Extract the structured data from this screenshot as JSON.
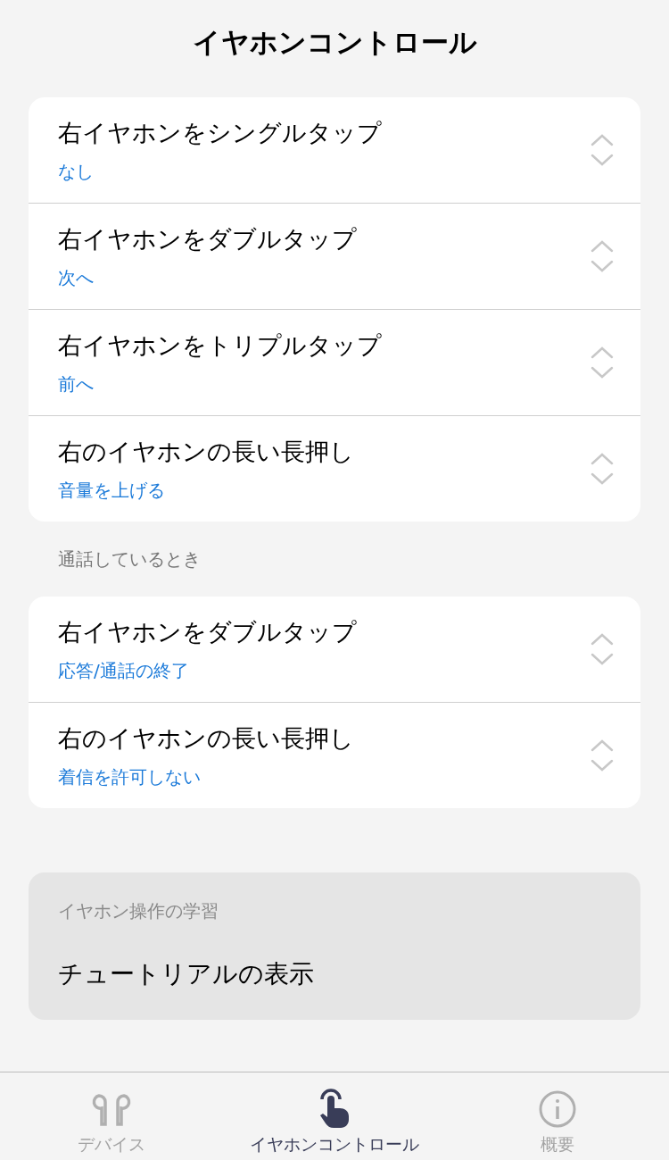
{
  "title": "イヤホンコントロール",
  "groups": [
    {
      "rows": [
        {
          "label": "右イヤホンをシングルタップ",
          "value": "なし"
        },
        {
          "label": "右イヤホンをダブルタップ",
          "value": "次へ"
        },
        {
          "label": "右イヤホンをトリプルタップ",
          "value": "前へ"
        },
        {
          "label": "右のイヤホンの長い長押し",
          "value": "音量を上げる"
        }
      ]
    },
    {
      "header": "通話しているとき",
      "rows": [
        {
          "label": "右イヤホンをダブルタップ",
          "value": "応答/通話の終了"
        },
        {
          "label": "右のイヤホンの長い長押し",
          "value": "着信を許可しない"
        }
      ]
    }
  ],
  "learning": {
    "header": "イヤホン操作の学習",
    "item": "チュートリアルの表示"
  },
  "tabs": [
    {
      "kind": "earbuds",
      "label": "デバイス",
      "selected": false
    },
    {
      "kind": "tap",
      "label": "イヤホンコントロール",
      "selected": true
    },
    {
      "kind": "info",
      "label": "概要",
      "selected": false
    }
  ]
}
